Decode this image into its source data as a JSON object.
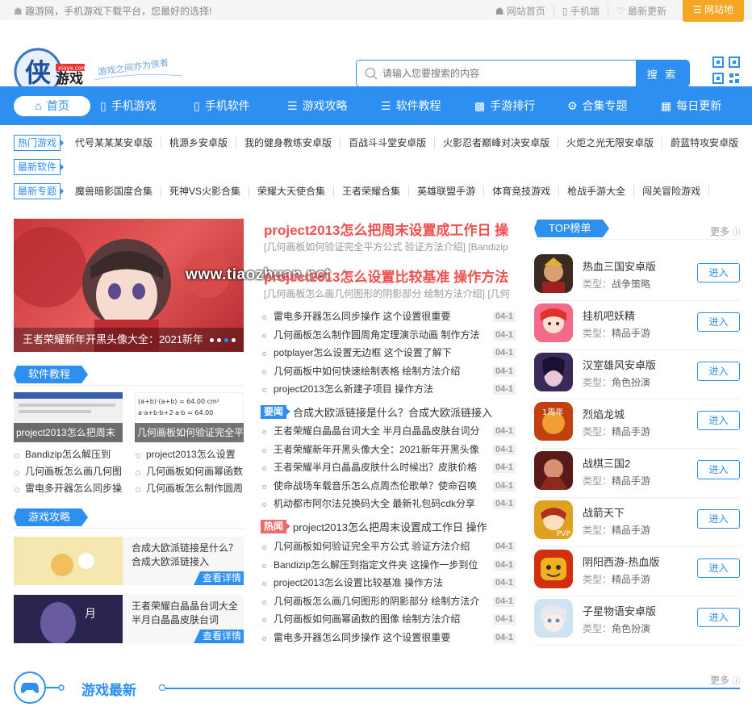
{
  "topbar": {
    "welcome": "趣游网，手机游戏下载平台，您最好的选择!",
    "links": [
      "网站首页",
      "手机端",
      "最新更新"
    ],
    "sitemap": "网站地"
  },
  "header": {
    "logo_main": "侠",
    "logo_sub": "游戏",
    "logo_domain": "xiayx.com",
    "slogan": "游戏之间亦为侠者",
    "search_placeholder": "请输入您要搜索的内容",
    "search_button": "搜 索"
  },
  "nav": [
    "首页",
    "手机游戏",
    "手机软件",
    "游戏攻略",
    "软件教程",
    "手游排行",
    "合集专题",
    "每日更新"
  ],
  "tags": {
    "hot_label": "热门游戏",
    "hot": [
      "代号某某某安卓版",
      "桃源乡安卓版",
      "我的健身教练安卓版",
      "百战斗斗堂安卓版",
      "火影忍者巅峰对决安卓版",
      "火炬之光无限安卓版",
      "蔚蓝特攻安卓版"
    ],
    "soft_label": "最新软件",
    "topic_label": "最新专题",
    "topics": [
      "魔兽暗影国度合集",
      "死神VS火影合集",
      "荣耀大天使合集",
      "王者荣耀合集",
      "英雄联盟手游",
      "体育竞技游戏",
      "枪战手游大全",
      "闯关冒险游戏"
    ]
  },
  "banner": {
    "caption": "王者荣耀新年开黑头像大全：2021新年"
  },
  "watermark": "www.tiaozhuan.net",
  "soft_tutorial": {
    "title": "软件教程",
    "thumbs": [
      "project2013怎么把周末",
      "几何画板如何验证完全平"
    ],
    "left": [
      "Bandizip怎么解压到",
      "几何画板怎么画几何图",
      "雷电多开器怎么同步操"
    ],
    "right": [
      "project2013怎么设置",
      "几何画板如何画幂函数",
      "几何画板怎么制作圆周"
    ]
  },
  "game_guide": {
    "title": "游戏攻略",
    "cards": [
      {
        "text": "合成大欧派链接是什么？合成大欧派链接入",
        "more": "查看详情"
      },
      {
        "text": "王者荣耀白晶晶台词大全 半月白晶晶皮肤台词",
        "more": "查看详情"
      }
    ]
  },
  "news": {
    "headline1": "project2013怎么把周末设置成工作日 操",
    "sub1": "[几何画板如何验证完全平方公式 验证方法介绍] [Bandizip",
    "headline2": "project2013怎么设置比较基准 操作方法",
    "sub2": "[几何画板怎么画几何图形的阴影部分 绘制方法介绍] [几何",
    "list1": [
      "雷电多开器怎么同步操作 这个设置很重要",
      "几何画板怎么制作圆周角定理演示动画 制作方法",
      "potplayer怎么设置无边框 这个设置了解下",
      "几何画板中如何快速绘制表格 绘制方法介绍",
      "project2013怎么新建子项目 操作方法"
    ],
    "flag1_label": "要闻",
    "flag1_title": "合成大欧派链接是什么？合成大欧派链接入",
    "list2": [
      "王者荣耀白晶晶台词大全 半月白晶晶皮肤台词分",
      "王者荣耀新年开黑头像大全：2021新年开黑头像",
      "王者荣耀半月白晶晶皮肤什么时候出？皮肤价格",
      "使命战场车载音乐怎么点周杰伦歌单？使命召唤",
      "机动都市阿尔法兑换码大全 最新礼包码cdk分享"
    ],
    "flag2_label": "热闻",
    "flag2_title": "project2013怎么把周末设置成工作日 操作",
    "list3": [
      "几何画板如何验证完全平方公式 验证方法介绍",
      "Bandizip怎么解压到指定文件夹 这操作一步到位",
      "project2013怎么设置比较基准 操作方法",
      "几何画板怎么画几何图形的阴影部分 绘制方法介",
      "几何画板如何画幂函数的图像 绘制方法介绍",
      "雷电多开器怎么同步操作 这个设置很重要"
    ],
    "date": "04-1"
  },
  "top": {
    "title": "TOP榜单",
    "more": "更多",
    "type_label": "类型：",
    "enter": "进入",
    "items": [
      {
        "name": "热血三国安卓版",
        "type": "战争策略"
      },
      {
        "name": "挂机吧妖精",
        "type": "精品手游"
      },
      {
        "name": "汉室雄风安卓版",
        "type": "角色扮演"
      },
      {
        "name": "烈焰龙城",
        "type": "精品手游"
      },
      {
        "name": "战棋三国2",
        "type": "精品手游"
      },
      {
        "name": "战箭天下",
        "type": "精品手游"
      },
      {
        "name": "阴阳西游-热血版",
        "type": "精品手游"
      },
      {
        "name": "子星物语安卓版",
        "type": "角色扮演"
      }
    ]
  },
  "latest": {
    "title": "游戏最新",
    "more": "更多"
  }
}
